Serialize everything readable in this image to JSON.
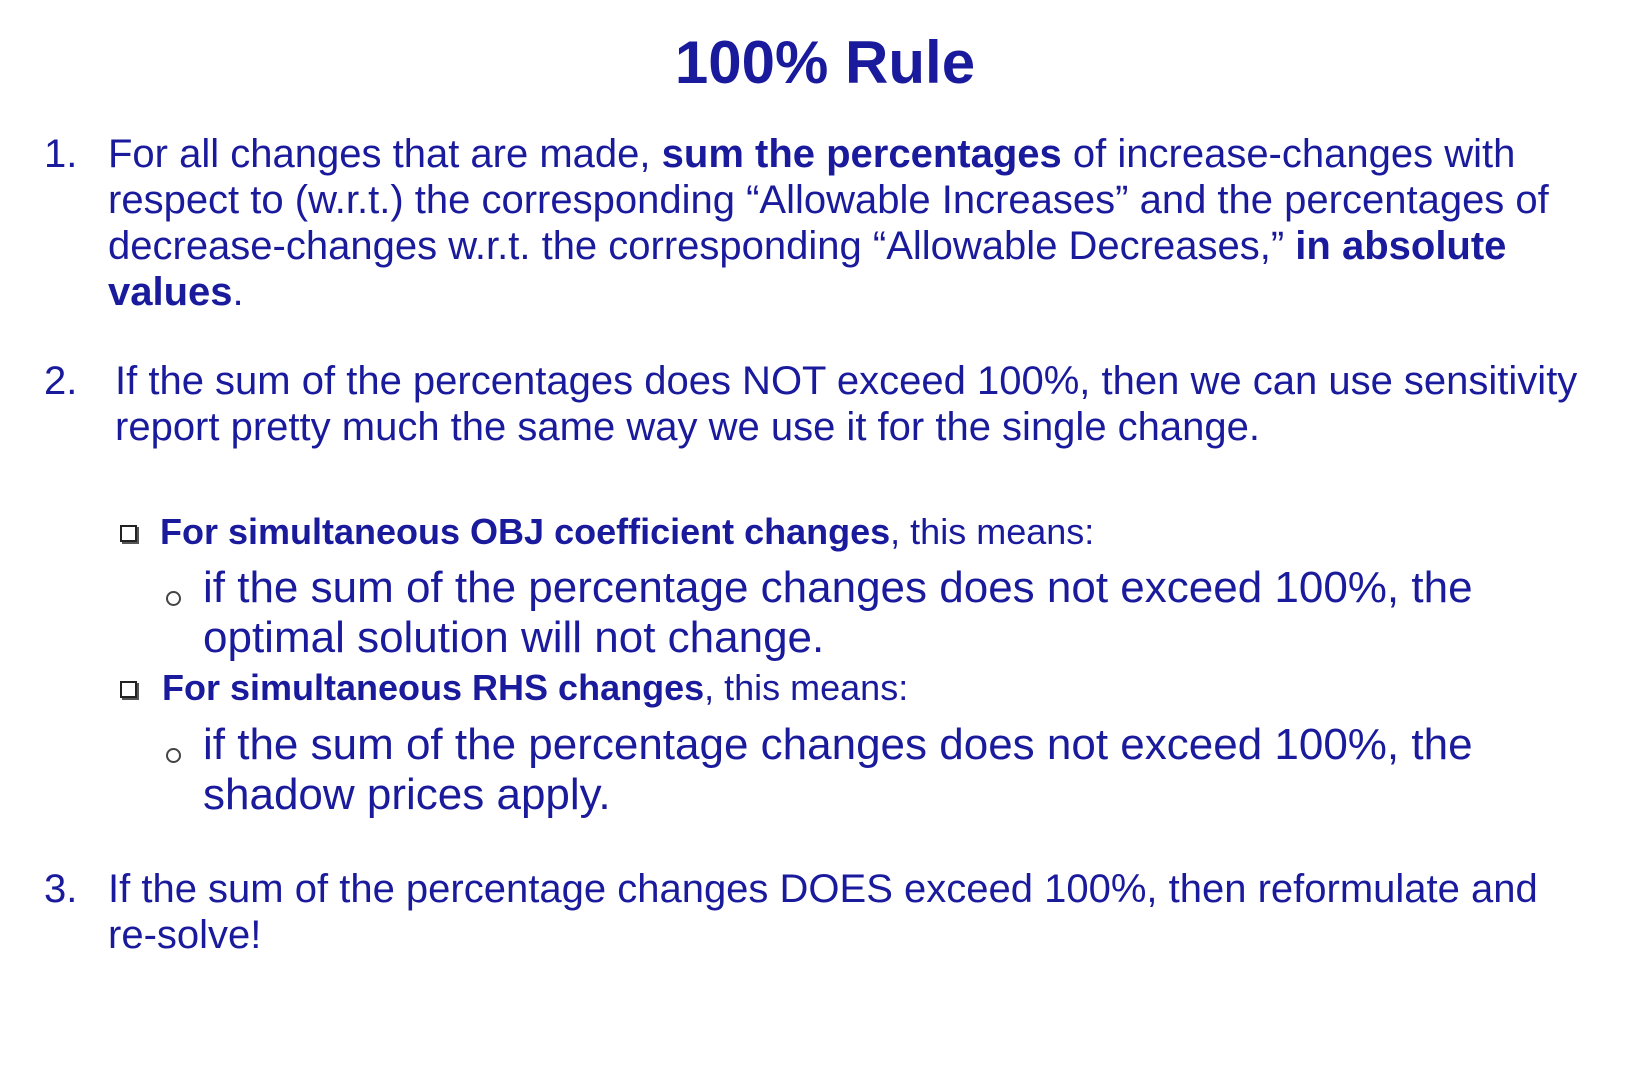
{
  "title": "100% Rule",
  "items": [
    {
      "number": "1.",
      "segments": [
        "For all changes that are made, ",
        "sum the percentages",
        " of increase-changes with respect to (w.r.t.) the corresponding “Allowable Increases” and the percentages of decrease-changes w.r.t. the corresponding “Allowable Decreases,” ",
        "in absolute values",
        "."
      ]
    },
    {
      "number": "2.",
      "text": "If the sum of the percentages does NOT exceed 100%, then we can use sensitivity report pretty much the same way we use it for the single change."
    },
    {
      "number": "3.",
      "text": "If the sum of the percentage changes DOES exceed 100%, then reformulate and re-solve!"
    }
  ],
  "subpoints": [
    {
      "heading_bold": "For simultaneous OBJ coefficient changes",
      "heading_rest": ", this means:",
      "detail": "if the sum of the percentage changes does not exceed 100%, the optimal solution will not change."
    },
    {
      "heading_bold": "For simultaneous RHS changes",
      "heading_rest": ", this means:",
      "detail": "if the sum of the percentage changes does not exceed 100%, the shadow prices apply."
    }
  ]
}
